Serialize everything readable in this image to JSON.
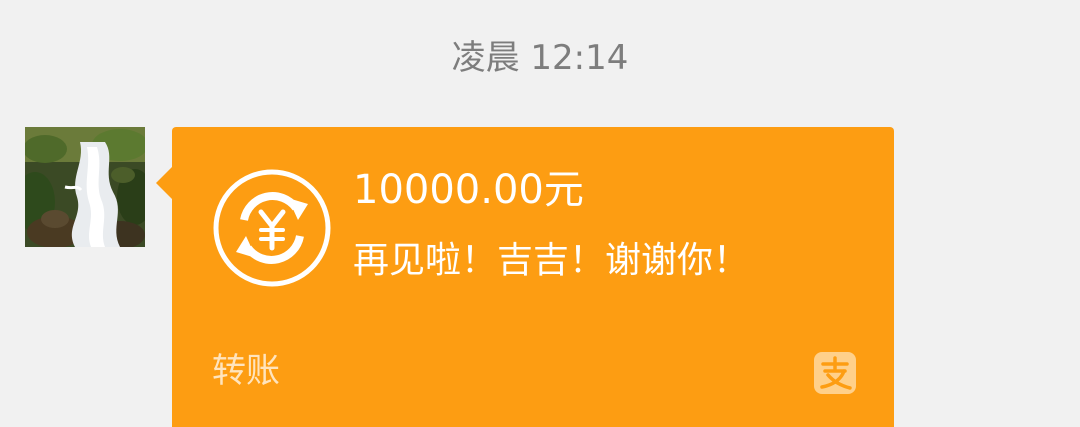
{
  "chat": {
    "timestamp": "凌晨 12:14"
  },
  "message_card": {
    "amount": "10000.00元",
    "note": "再见啦！吉吉！谢谢你！",
    "type_label": "转账"
  },
  "icons": {
    "avatar": "waterfall-photo-avatar",
    "transfer": "currency-transfer-icon",
    "brand": "alipay-logo-icon"
  },
  "colors": {
    "card_background": "#fd9d12",
    "chat_background": "#f1f1f1",
    "timestamp_text": "#7d7d7d"
  }
}
